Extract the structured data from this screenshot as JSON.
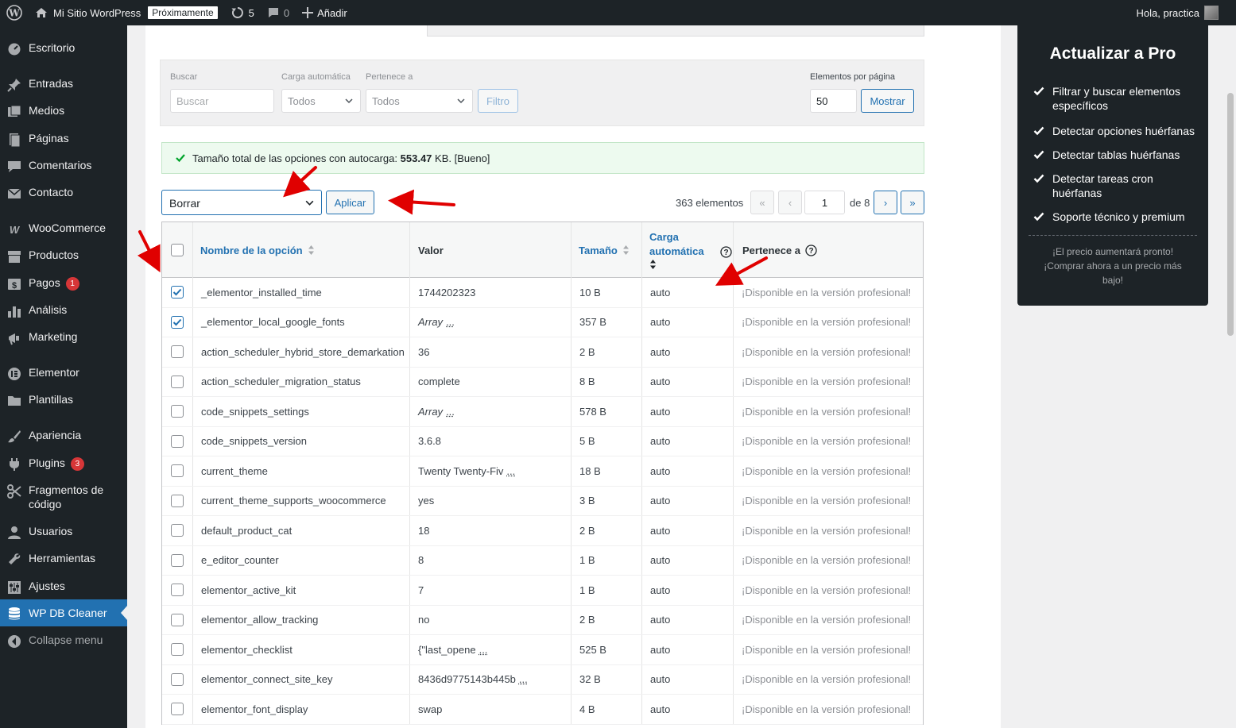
{
  "adminbar": {
    "site_name": "Mi Sitio WordPress",
    "status_badge": "Próximamente",
    "updates_count": "5",
    "comments_count": "0",
    "add_label": "Añadir",
    "greeting": "Hola, practica"
  },
  "sidebar": {
    "items": [
      {
        "label": "Escritorio",
        "icon": "dashboard-icon"
      },
      {
        "label": "Entradas",
        "icon": "pin-icon"
      },
      {
        "label": "Medios",
        "icon": "media-icon"
      },
      {
        "label": "Páginas",
        "icon": "page-icon"
      },
      {
        "label": "Comentarios",
        "icon": "comment-icon"
      },
      {
        "label": "Contacto",
        "icon": "mail-icon"
      },
      {
        "label": "WooCommerce",
        "icon": "woo-icon"
      },
      {
        "label": "Productos",
        "icon": "archive-icon"
      },
      {
        "label": "Pagos",
        "icon": "money-icon",
        "badge": "1"
      },
      {
        "label": "Análisis",
        "icon": "chart-icon"
      },
      {
        "label": "Marketing",
        "icon": "megaphone-icon"
      },
      {
        "label": "Elementor",
        "icon": "elementor-icon"
      },
      {
        "label": "Plantillas",
        "icon": "folder-icon"
      },
      {
        "label": "Apariencia",
        "icon": "brush-icon"
      },
      {
        "label": "Plugins",
        "icon": "plugin-icon",
        "badge": "3"
      },
      {
        "label": "Fragmentos de código",
        "icon": "scissors-icon"
      },
      {
        "label": "Usuarios",
        "icon": "user-icon"
      },
      {
        "label": "Herramientas",
        "icon": "wrench-icon"
      },
      {
        "label": "Ajustes",
        "icon": "sliders-icon"
      },
      {
        "label": "WP DB Cleaner",
        "icon": "database-icon"
      },
      {
        "label": "Collapse menu",
        "icon": "collapse-icon"
      }
    ]
  },
  "filters": {
    "search_label": "Buscar",
    "search_placeholder": "Buscar",
    "autoload_label": "Carga automática",
    "autoload_value": "Todos",
    "belongs_label": "Pertenece a",
    "belongs_value": "Todos",
    "filter_button": "Filtro",
    "per_page_label": "Elementos por página",
    "per_page_value": "50",
    "show_button": "Mostrar"
  },
  "notice": {
    "prefix": "Tamaño total de las opciones con autocarga:",
    "size": "553.47",
    "suffix": "KB. [Bueno]"
  },
  "bulk": {
    "action": "Borrar",
    "apply": "Aplicar"
  },
  "pagination": {
    "total": "363 elementos",
    "first": "«",
    "prev": "‹",
    "current": "1",
    "of_label": "de 8",
    "next": "›",
    "last": "»"
  },
  "table": {
    "headers": {
      "name": "Nombre de la opción",
      "value": "Valor",
      "size": "Tamaño",
      "autoload_1": "Carga",
      "autoload_2": "automática",
      "belongs": "Pertenece a"
    },
    "pro_text": "¡Disponible en la versión profesional!",
    "rows": [
      {
        "name": "_elementor_installed_time",
        "value": "1744202323",
        "more": "",
        "size": "10 B",
        "autoload": "auto",
        "checked": true
      },
      {
        "name": "_elementor_local_google_fonts",
        "value": "Array",
        "more": "...",
        "size": "357 B",
        "autoload": "auto",
        "checked": true,
        "italic": true
      },
      {
        "name": "action_scheduler_hybrid_store_demarkation",
        "value": "36",
        "more": "",
        "size": "2 B",
        "autoload": "auto",
        "checked": false
      },
      {
        "name": "action_scheduler_migration_status",
        "value": "complete",
        "more": "",
        "size": "8 B",
        "autoload": "auto",
        "checked": false
      },
      {
        "name": "code_snippets_settings",
        "value": "Array",
        "more": "...",
        "size": "578 B",
        "autoload": "auto",
        "checked": false,
        "italic": true
      },
      {
        "name": "code_snippets_version",
        "value": "3.6.8",
        "more": "",
        "size": "5 B",
        "autoload": "auto",
        "checked": false
      },
      {
        "name": "current_theme",
        "value": "Twenty Twenty-Fiv",
        "more": "...",
        "size": "18 B",
        "autoload": "auto",
        "checked": false
      },
      {
        "name": "current_theme_supports_woocommerce",
        "value": "yes",
        "more": "",
        "size": "3 B",
        "autoload": "auto",
        "checked": false
      },
      {
        "name": "default_product_cat",
        "value": "18",
        "more": "",
        "size": "2 B",
        "autoload": "auto",
        "checked": false
      },
      {
        "name": "e_editor_counter",
        "value": "8",
        "more": "",
        "size": "1 B",
        "autoload": "auto",
        "checked": false
      },
      {
        "name": "elementor_active_kit",
        "value": "7",
        "more": "",
        "size": "1 B",
        "autoload": "auto",
        "checked": false
      },
      {
        "name": "elementor_allow_tracking",
        "value": "no",
        "more": "",
        "size": "2 B",
        "autoload": "auto",
        "checked": false
      },
      {
        "name": "elementor_checklist",
        "value": "{\"last_opene",
        "more": "...",
        "size": "525 B",
        "autoload": "auto",
        "checked": false
      },
      {
        "name": "elementor_connect_site_key",
        "value": "8436d9775143b445b",
        "more": "...",
        "size": "32 B",
        "autoload": "auto",
        "checked": false
      },
      {
        "name": "elementor_font_display",
        "value": "swap",
        "more": "",
        "size": "4 B",
        "autoload": "auto",
        "checked": false
      }
    ]
  },
  "pro_panel": {
    "title": "Actualizar a Pro",
    "features": [
      "Filtrar y buscar elementos específicos",
      "Detectar opciones huérfanas",
      "Detectar tablas huérfanas",
      "Detectar tareas cron huérfanas",
      "Soporte técnico y premium"
    ],
    "note": "¡El precio aumentará pronto! ¡Comprar ahora a un precio más bajo!"
  },
  "colors": {
    "accent": "#2271b1",
    "adminbar": "#1d2327",
    "annotation_arrow": "#e00000"
  }
}
